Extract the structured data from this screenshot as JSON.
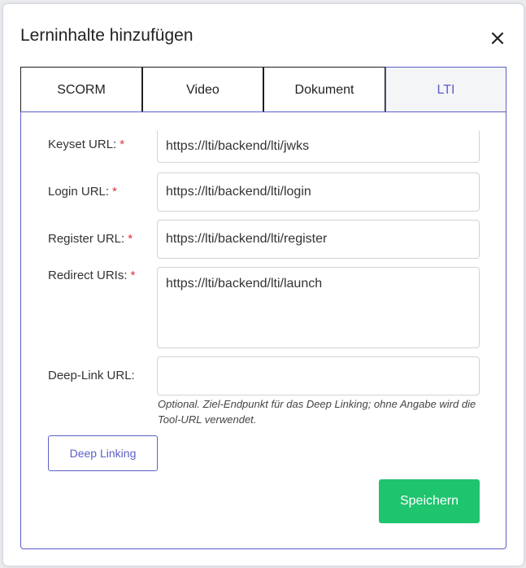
{
  "modal": {
    "title": "Lerninhalte hinzufügen",
    "close_icon": "close-icon"
  },
  "tabs": [
    {
      "label": "SCORM"
    },
    {
      "label": "Video"
    },
    {
      "label": "Dokument"
    },
    {
      "label": "LTI",
      "active": true
    }
  ],
  "form": {
    "required_marker": "*",
    "keyset": {
      "label": "Keyset URL:",
      "value": "https://lti/backend/lti/jwks"
    },
    "login": {
      "label": "Login URL:",
      "value": "https://lti/backend/lti/login"
    },
    "register": {
      "label": "Register URL:",
      "value": "https://lti/backend/lti/register"
    },
    "redirect": {
      "label": "Redirect URIs:",
      "value": "https://lti/backend/lti/launch"
    },
    "deeplink": {
      "label": "Deep-Link URL:",
      "value": "",
      "hint": "Optional. Ziel-Endpunkt für das Deep Linking; ohne Angabe wird die Tool-URL verwendet."
    }
  },
  "buttons": {
    "deep_linking": "Deep Linking",
    "save": "Speichern"
  },
  "colors": {
    "accent": "#5b5fc7",
    "save": "#1fc46f",
    "required": "#e0303c"
  }
}
